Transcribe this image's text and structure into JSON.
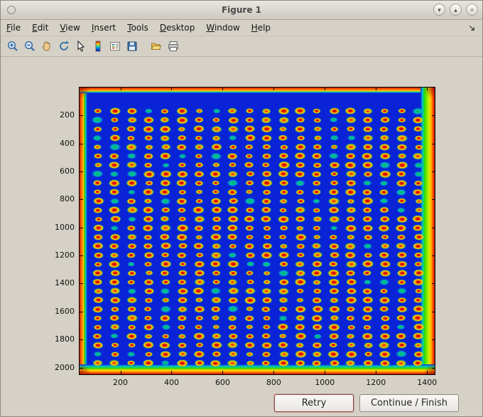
{
  "window": {
    "title": "Figure 1",
    "controls": {
      "minimize": "▾",
      "maximize": "▴",
      "close": "×"
    }
  },
  "menu": {
    "items": [
      "File",
      "Edit",
      "View",
      "Insert",
      "Tools",
      "Desktop",
      "Window",
      "Help"
    ]
  },
  "toolbar": {
    "icons": [
      "zoom-in",
      "zoom-out",
      "pan",
      "rotate-3d",
      "data-cursor",
      "colorbar",
      "legend",
      "save",
      "separator",
      "open-folder",
      "print"
    ]
  },
  "figure": {
    "axes": {
      "x_ticks": [
        200,
        400,
        600,
        800,
        1000,
        1200,
        1400
      ],
      "y_ticks": [
        200,
        400,
        600,
        800,
        1000,
        1200,
        1400,
        1600,
        1800,
        2000
      ],
      "x_range": [
        40,
        1430
      ],
      "y_range": [
        0,
        2048
      ]
    },
    "image": {
      "colormap": "jet",
      "background_color": "#0a23d6",
      "grid": {
        "rows": 29,
        "cols": 20,
        "x0": 112,
        "y0": 168,
        "dx": 66,
        "dy": 64.3
      },
      "seed": 20177
    }
  },
  "buttons": {
    "retry": "Retry",
    "continue_finish": "Continue / Finish"
  }
}
